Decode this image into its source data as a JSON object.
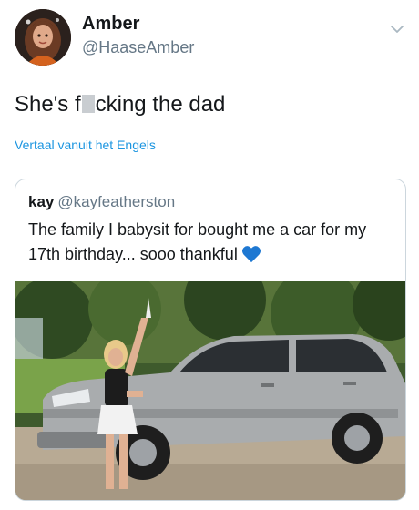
{
  "tweet": {
    "display_name": "Amber",
    "handle": "@HaaseAmber",
    "text_before": "She's f",
    "text_after": "cking the dad",
    "translate_label": "Vertaal vanuit het Engels"
  },
  "quoted_tweet": {
    "display_name": "kay",
    "handle": "@kayfeatherston",
    "text": "The family I babysit for bought me a car for my 17th birthday... sooo thankful",
    "emoji_icon": "blue-heart-icon"
  },
  "colors": {
    "link_blue": "#1b95e0",
    "secondary_text": "#657786",
    "border": "#ccd6dd",
    "heart_blue": "#1e78d2"
  }
}
